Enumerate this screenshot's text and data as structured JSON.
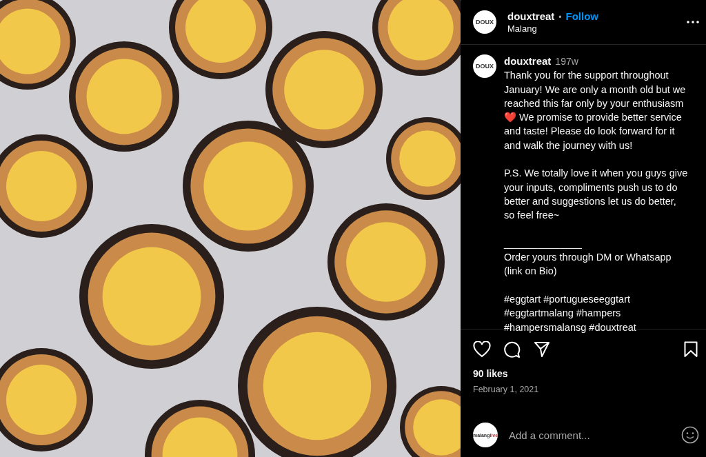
{
  "header": {
    "avatar_text": "DOUX",
    "username": "douxtreat",
    "separator": "•",
    "follow": "Follow",
    "location": "Malang"
  },
  "caption": {
    "avatar_text": "DOUX",
    "username": "douxtreat",
    "age": "197w",
    "paragraphs": [
      [
        "Thank you for the support throughout January! We are only a month old but we reached this far only by your enthusiasm ❤️ We promise to provide better service and taste! Please do look forward for it and walk the journey with us!"
      ],
      [
        "P.S. We totally love it when you guys give your inputs, compliments push us to do better and suggestions let us do better, so feel free~"
      ],
      [
        "______________",
        "Order yours through DM or Whatsapp (link on Bio)"
      ],
      [
        "#eggtart #portugueseeggtart #eggtartmalang #hampers #hampersmalansg #douxtreat"
      ]
    ]
  },
  "likes": "90 likes",
  "date": "February 1, 2021",
  "comment": {
    "avatar_text": [
      "malang",
      "live"
    ],
    "placeholder": "Add a comment..."
  }
}
